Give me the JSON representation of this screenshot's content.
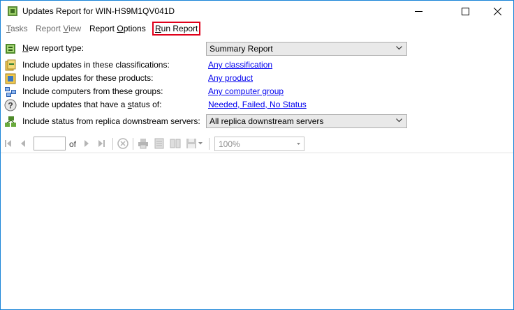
{
  "window": {
    "title": "Updates Report for WIN-HS9M1QV041D",
    "minimize_label": "minimize",
    "maximize_label": "maximize",
    "close_label": "close"
  },
  "menu": {
    "tasks": {
      "u": "T",
      "rest": "asks"
    },
    "report_view": {
      "pre": "Report ",
      "u": "V",
      "rest": "iew"
    },
    "report_options": {
      "pre": "Report ",
      "u": "O",
      "rest": "ptions"
    },
    "run_report": {
      "u": "R",
      "rest": "un Report"
    }
  },
  "form": {
    "report_type_label": {
      "u": "N",
      "rest": "ew report type:"
    },
    "report_type_value": "Summary Report",
    "classifications_label": "Include updates in these classifications:",
    "classifications_link": "Any classification",
    "products_label": "Include updates for these products:",
    "products_link": "Any product",
    "groups_label": "Include computers from these groups:",
    "groups_link": "Any computer group",
    "status_label": {
      "pre": "Include updates that have a ",
      "u": "s",
      "rest": "tatus of:"
    },
    "status_link": "Needed, Failed, No Status",
    "replica_label": "Include status from replica downstream servers:",
    "replica_value": "All replica downstream servers"
  },
  "toolbar": {
    "page_value": "",
    "of_label": "of",
    "zoom_value": "100%"
  },
  "colors": {
    "accent_border": "#1883d7",
    "link": "#0000ee",
    "highlight": "#e0001a"
  }
}
